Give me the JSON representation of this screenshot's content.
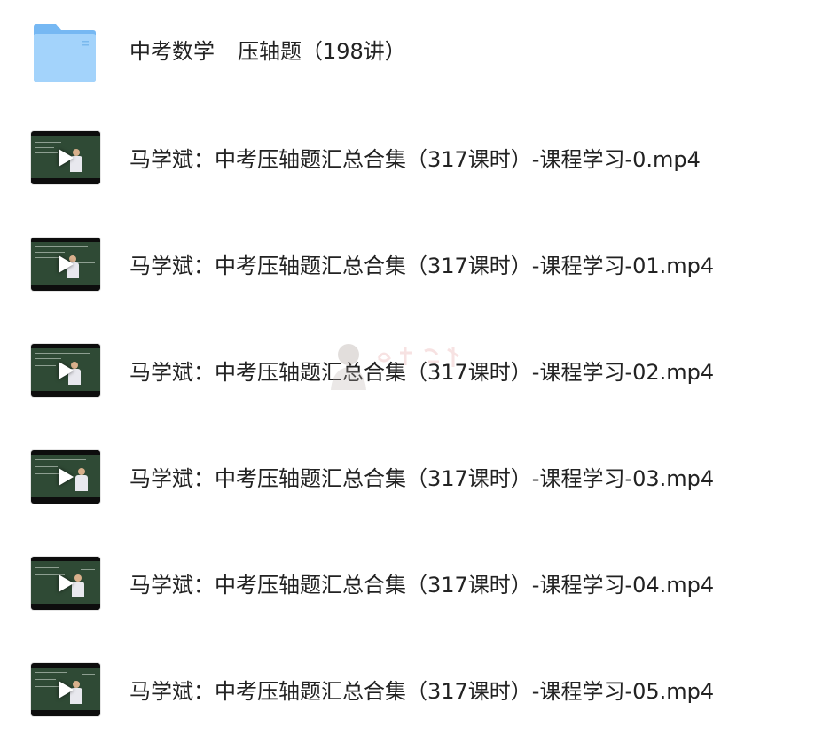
{
  "folder": {
    "name_part1": "中考数学",
    "name_part2": "压轴题（198讲）",
    "icon": "folder-icon"
  },
  "files": [
    {
      "name": "马学斌：中考压轴题汇总合集（317课时）-课程学习-0.mp4",
      "icon": "video-thumbnail-icon"
    },
    {
      "name": "马学斌：中考压轴题汇总合集（317课时）-课程学习-01.mp4",
      "icon": "video-thumbnail-icon"
    },
    {
      "name": "马学斌：中考压轴题汇总合集（317课时）-课程学习-02.mp4",
      "icon": "video-thumbnail-icon"
    },
    {
      "name": "马学斌：中考压轴题汇总合集（317课时）-课程学习-03.mp4",
      "icon": "video-thumbnail-icon"
    },
    {
      "name": "马学斌：中考压轴题汇总合集（317课时）-课程学习-04.mp4",
      "icon": "video-thumbnail-icon"
    },
    {
      "name": "马学斌：中考压轴题汇总合集（317课时）-课程学习-05.mp4",
      "icon": "video-thumbnail-icon"
    }
  ],
  "colors": {
    "folder_blue": "#8cc8f7",
    "text": "#222222",
    "chalkboard": "#2f4a35"
  }
}
